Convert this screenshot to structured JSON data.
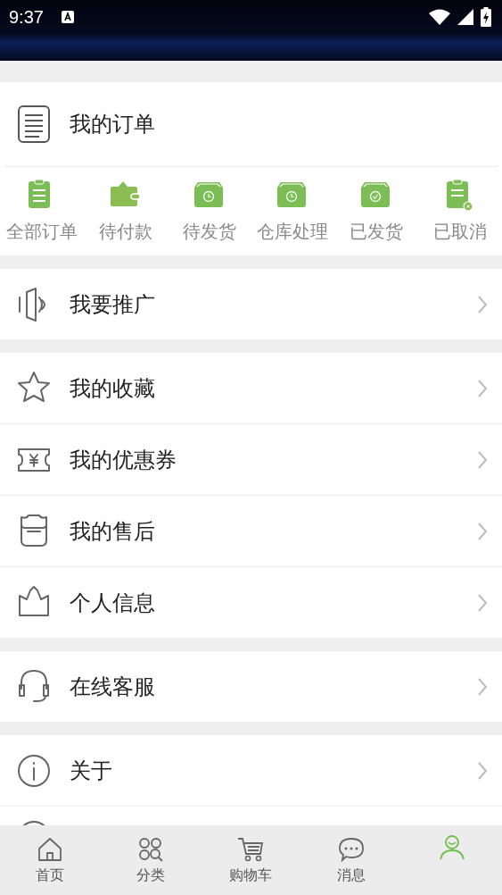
{
  "status_bar": {
    "time": "9:37"
  },
  "orders": {
    "title": "我的订单",
    "items": [
      {
        "label": "全部订单"
      },
      {
        "label": "待付款"
      },
      {
        "label": "待发货"
      },
      {
        "label": "仓库处理"
      },
      {
        "label": "已发货"
      },
      {
        "label": "已取消"
      }
    ]
  },
  "sections": [
    {
      "items": [
        {
          "kind": "link",
          "label": "我要推广"
        }
      ]
    },
    {
      "items": [
        {
          "kind": "link",
          "label": "我的收藏"
        },
        {
          "kind": "link",
          "label": "我的优惠券"
        },
        {
          "kind": "link",
          "label": "我的售后"
        },
        {
          "kind": "link",
          "label": "个人信息"
        }
      ]
    },
    {
      "items": [
        {
          "kind": "link",
          "label": "在线客服"
        }
      ]
    },
    {
      "items": [
        {
          "kind": "link",
          "label": "关于"
        },
        {
          "kind": "cut"
        }
      ]
    }
  ],
  "tabs": [
    {
      "label": "首页",
      "selected": false
    },
    {
      "label": "分类",
      "selected": false
    },
    {
      "label": "购物车",
      "selected": false
    },
    {
      "label": "消息",
      "selected": false
    },
    {
      "selected": true
    }
  ]
}
